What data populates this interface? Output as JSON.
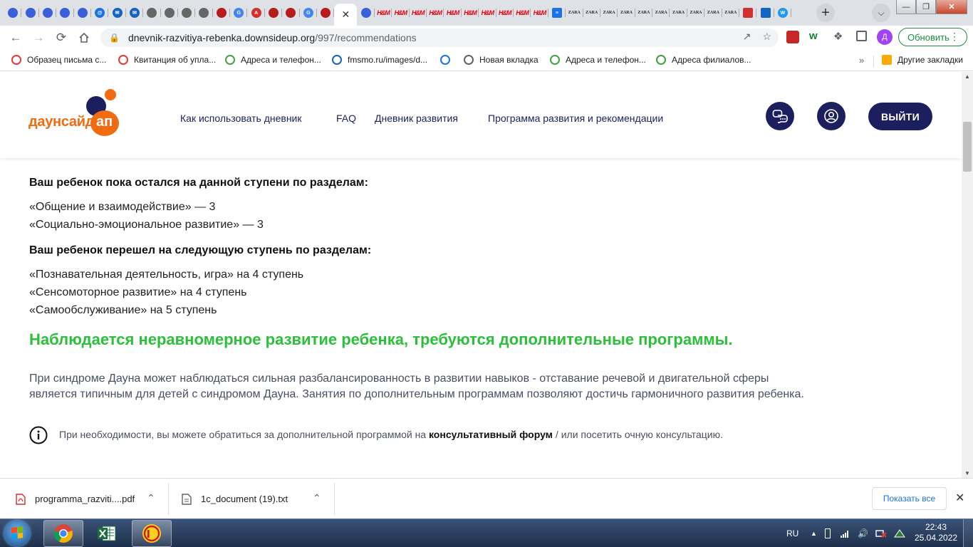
{
  "browser": {
    "tab_close_glyph": "✕",
    "new_tab_glyph": "+",
    "tabs": [
      {
        "icon": "multi-dot-icon",
        "color": "#3b5fd6",
        "label": ""
      },
      {
        "icon": "multi-dot-icon",
        "color": "#3b5fd6",
        "label": ""
      },
      {
        "icon": "multi-dot-icon",
        "color": "#3b5fd6",
        "label": ""
      },
      {
        "icon": "multi-dot-icon",
        "color": "#3b5fd6",
        "label": ""
      },
      {
        "icon": "multi-dot-icon",
        "color": "#3b5fd6",
        "label": ""
      },
      {
        "icon": "mail-at-icon",
        "color": "#1a73e8",
        "label": "@"
      },
      {
        "icon": "mail-envelope-icon",
        "color": "#1565c0",
        "label": "✉"
      },
      {
        "icon": "mail-envelope-icon",
        "color": "#1565c0",
        "label": "✉"
      },
      {
        "icon": "globe-icon",
        "color": "#666",
        "label": ""
      },
      {
        "icon": "globe-icon",
        "color": "#666",
        "label": ""
      },
      {
        "icon": "globe-icon",
        "color": "#666",
        "label": ""
      },
      {
        "icon": "globe-icon",
        "color": "#666",
        "label": ""
      },
      {
        "icon": "building-icon",
        "color": "#b71c1c",
        "label": ""
      },
      {
        "icon": "google-icon",
        "color": "#4285f4",
        "label": "G"
      },
      {
        "icon": "triangle-icon",
        "color": "#d32f2f",
        "label": "A"
      },
      {
        "icon": "building-icon",
        "color": "#b71c1c",
        "label": ""
      },
      {
        "icon": "building-icon",
        "color": "#b71c1c",
        "label": ""
      },
      {
        "icon": "google-icon",
        "color": "#4285f4",
        "label": "G"
      },
      {
        "icon": "building-icon",
        "color": "#b71c1c",
        "label": ""
      }
    ],
    "tabs_after": [
      {
        "icon": "multi-dot-icon",
        "color": "#3b5fd6",
        "label": "",
        "kind": "dot"
      },
      {
        "icon": "hm-icon",
        "color": "#e50010",
        "label": "H&M",
        "kind": "txt"
      },
      {
        "icon": "hm-icon",
        "color": "#e50010",
        "label": "H&M",
        "kind": "txt"
      },
      {
        "icon": "hm-icon",
        "color": "#e50010",
        "label": "H&M",
        "kind": "txt"
      },
      {
        "icon": "hm-icon",
        "color": "#e50010",
        "label": "H&M",
        "kind": "txt"
      },
      {
        "icon": "hm-icon",
        "color": "#e50010",
        "label": "H&M",
        "kind": "txt"
      },
      {
        "icon": "hm-icon",
        "color": "#e50010",
        "label": "H&M",
        "kind": "txt"
      },
      {
        "icon": "hm-icon",
        "color": "#e50010",
        "label": "H&M",
        "kind": "txt"
      },
      {
        "icon": "hm-icon",
        "color": "#e50010",
        "label": "H&M",
        "kind": "txt"
      },
      {
        "icon": "hm-icon",
        "color": "#e50010",
        "label": "H&M",
        "kind": "txt"
      },
      {
        "icon": "hm-icon",
        "color": "#e50010",
        "label": "H&M",
        "kind": "txt"
      },
      {
        "icon": "stripes-icon",
        "color": "#1a73e8",
        "label": "≡",
        "kind": "box"
      },
      {
        "icon": "zara-icon",
        "color": "#222",
        "label": "ZARA",
        "kind": "zara"
      },
      {
        "icon": "zara-icon",
        "color": "#222",
        "label": "ZARA",
        "kind": "zara"
      },
      {
        "icon": "zara-icon",
        "color": "#222",
        "label": "ZARA",
        "kind": "zara"
      },
      {
        "icon": "zara-icon",
        "color": "#222",
        "label": "ZARA",
        "kind": "zara"
      },
      {
        "icon": "zara-icon",
        "color": "#222",
        "label": "ZARA",
        "kind": "zara"
      },
      {
        "icon": "zara-icon",
        "color": "#222",
        "label": "ZARA",
        "kind": "zara"
      },
      {
        "icon": "zara-icon",
        "color": "#222",
        "label": "ZARA",
        "kind": "zara"
      },
      {
        "icon": "zara-icon",
        "color": "#222",
        "label": "ZARA",
        "kind": "zara"
      },
      {
        "icon": "zara-icon",
        "color": "#222",
        "label": "ZARA",
        "kind": "zara"
      },
      {
        "icon": "zara-icon",
        "color": "#222",
        "label": "ZARA",
        "kind": "zara"
      },
      {
        "icon": "flag-icon",
        "color": "#d32f2f",
        "label": "",
        "kind": "box"
      },
      {
        "icon": "news-icon",
        "color": "#1565c0",
        "label": "",
        "kind": "box"
      },
      {
        "icon": "wp-icon",
        "color": "#2196f3",
        "label": "W",
        "kind": "dot"
      }
    ],
    "url_host": "dnevnik-razvitiya-rebenka.downsideup.org",
    "url_path": "/997/recommendations",
    "profile_initial": "Д",
    "update_label": "Обновить",
    "bookmarks": [
      {
        "label": "Образец письма с...",
        "icon": "bookmark-sun-icon",
        "color": "#e53935"
      },
      {
        "label": "Квитанция об упла...",
        "icon": "bookmark-sun-icon",
        "color": "#e53935"
      },
      {
        "label": "Адреса и телефон...",
        "icon": "bookmark-eye-icon",
        "color": "#43a047"
      },
      {
        "label": "fmsmo.ru/images/d...",
        "icon": "bookmark-crest-icon",
        "color": "#1565c0"
      },
      {
        "label": "",
        "icon": "bookmark-check-icon",
        "color": "#1a73e8"
      },
      {
        "label": "Новая вкладка",
        "icon": "bookmark-globe-icon",
        "color": "#5f6368"
      },
      {
        "label": "Адреса и телефон...",
        "icon": "bookmark-eye-icon",
        "color": "#43a047"
      },
      {
        "label": "Адреса филиалов...",
        "icon": "bookmark-eye-icon",
        "color": "#43a047"
      }
    ],
    "bookmarks_more": "»",
    "other_bookmarks": "Другие закладки"
  },
  "site": {
    "logo_word1": "даунсайд",
    "logo_word2": "ап",
    "nav": [
      "Как использовать дневник",
      "FAQ",
      "Дневник развития",
      "Программа развития и рекомендации"
    ],
    "logout_label": "ВЫЙТИ"
  },
  "content": {
    "stayed_heading": "Ваш ребенок пока остался на данной ступени по разделам:",
    "stayed_items": [
      "«Общение и взаимодействие» — 3",
      "«Социально-эмоциональное развитие» — 3"
    ],
    "moved_heading": "Ваш ребенок перешел на следующую ступень по разделам:",
    "moved_items": [
      "«Познавательная деятельность, игра» на 4 ступень",
      "«Сенсомоторное развитие» на 4 ступень",
      "«Самообслуживание» на 5 ступень"
    ],
    "conclusion": "Наблюдается неравномерное развитие ребенка, требуются дополнительные программы.",
    "paragraph_line1": "При синдроме Дауна может наблюдаться сильная разбалансированность в развитии навыков - отставание речевой и двигательной сферы",
    "paragraph_line2": "является типичным для детей с синдромом Дауна. Занятия по дополнительным программам позволяют достичь гармоничного развития ребенка.",
    "info_before": "При необходимости, вы можете обратиться за дополнительной программой на ",
    "info_link": "консультативный форум",
    "info_after": " / или посетить очную консультацию."
  },
  "downloads": {
    "items": [
      {
        "name": "programma_razviti....pdf",
        "icon": "pdf-icon"
      },
      {
        "name": "1c_document (19).txt",
        "icon": "text-file-icon"
      }
    ],
    "show_all": "Показать все"
  },
  "taskbar": {
    "lang": "RU",
    "time": "22:43",
    "date": "25.04.2022"
  },
  "colors": {
    "brand_navy": "#1b1f5e",
    "brand_orange": "#f26b10",
    "conclusion_green": "#2bbf3a"
  }
}
